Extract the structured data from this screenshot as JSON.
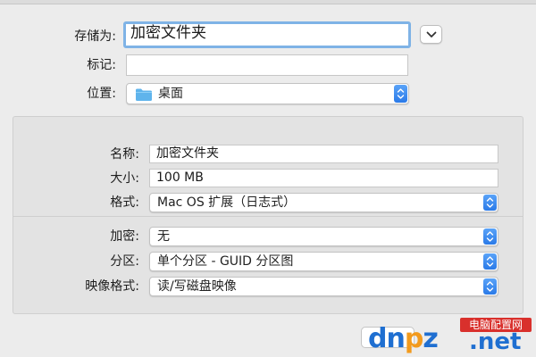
{
  "save_dialog": {
    "save_as_label": "存储为:",
    "save_as_value": "加密文件夹",
    "tags_label": "标记:",
    "tags_value": "",
    "location_label": "位置:",
    "location_value": "桌面",
    "location_icon": "folder-icon"
  },
  "options": {
    "name_label": "名称:",
    "name_value": "加密文件夹",
    "size_label": "大小:",
    "size_value": "100 MB",
    "format_label": "格式:",
    "format_value": "Mac OS 扩展（日志式）",
    "encryption_label": "加密:",
    "encryption_value": "无",
    "partition_label": "分区:",
    "partition_value": "单个分区 - GUID 分区图",
    "image_format_label": "映像格式:",
    "image_format_value": "读/写磁盘映像"
  },
  "watermark": {
    "letters_pre": "dn",
    "letters_o": "p",
    "letters_post": "z",
    "tag": "电脑配置网",
    "suffix": ".net"
  },
  "colors": {
    "accent_blue": "#2a7ae8",
    "focus_ring": "#7fb3e6",
    "folder_blue": "#5fb4ec"
  }
}
